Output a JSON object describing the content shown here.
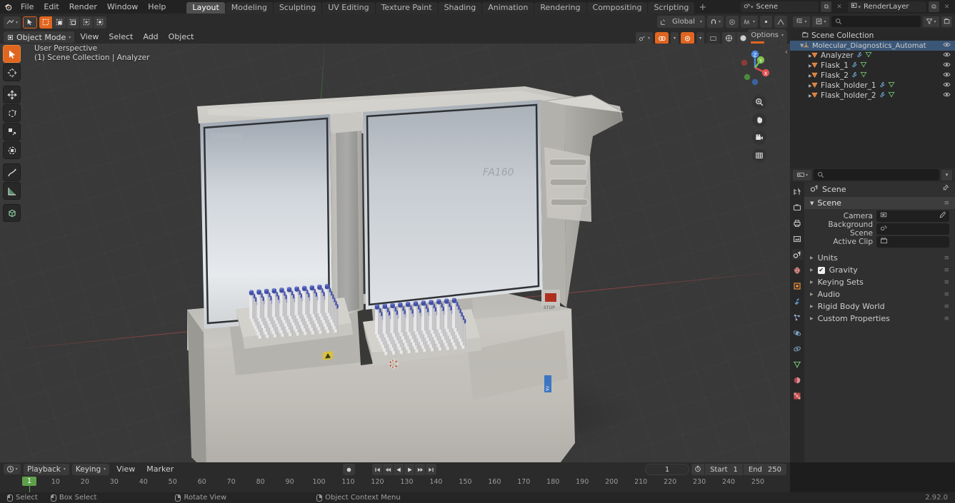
{
  "app": {
    "name": "Blender",
    "version": "2.92.0"
  },
  "topbar": {
    "logo_icon": "blender-logo-icon",
    "menus": [
      "File",
      "Edit",
      "Render",
      "Window",
      "Help"
    ],
    "workspace_tabs": [
      {
        "label": "Layout",
        "active": true
      },
      {
        "label": "Modeling",
        "active": false
      },
      {
        "label": "Sculpting",
        "active": false
      },
      {
        "label": "UV Editing",
        "active": false
      },
      {
        "label": "Texture Paint",
        "active": false
      },
      {
        "label": "Shading",
        "active": false
      },
      {
        "label": "Animation",
        "active": false
      },
      {
        "label": "Rendering",
        "active": false
      },
      {
        "label": "Compositing",
        "active": false
      },
      {
        "label": "Scripting",
        "active": false
      }
    ],
    "add_workspace_label": "+",
    "scene_name": "Scene",
    "view_layer_name": "RenderLayer",
    "new_scene_icon": "copy-icon",
    "remove_scene_icon": "x-icon",
    "new_layer_icon": "copy-icon",
    "remove_layer_icon": "x-icon"
  },
  "viewport": {
    "header": {
      "editor_type_icon": "editor-type-icon",
      "cursor_select_icon": "cursor-icon",
      "select_mode_icons": [
        "select-set-icon",
        "select-extend-icon",
        "select-subtract-icon",
        "select-invert-icon",
        "select-intersect-icon"
      ],
      "mode_label": "Object Mode",
      "mode_icon": "object-mode-icon",
      "menus": [
        "View",
        "Select",
        "Add",
        "Object"
      ],
      "transform_orientation": "Global",
      "orientation_icon": "orientation-icon",
      "snap_icon": "magnet-icon",
      "proportional_icon": "proportional-edit-icon",
      "proportional_falloff_icon": "falloff-icon",
      "options_label": "Options",
      "overlay_icons": [
        "gizmo-icon",
        "overlays-icon",
        "xray-icon",
        "shading-wireframe-icon",
        "shading-solid-icon",
        "shading-material-icon",
        "shading-rendered-icon"
      ]
    },
    "overlay": {
      "perspective_label": "User Perspective",
      "context_label": "(1) Scene Collection | Analyzer"
    },
    "toolbar": [
      {
        "name": "tweak-tool",
        "icon": "cursor-arrow-icon",
        "active": true
      },
      {
        "name": "cursor-tool",
        "icon": "3d-cursor-icon",
        "active": false
      },
      {
        "name": "move-tool",
        "icon": "move-arrows-icon",
        "active": false
      },
      {
        "name": "rotate-tool",
        "icon": "rotate-icon",
        "active": false
      },
      {
        "name": "scale-tool",
        "icon": "scale-icon",
        "active": false
      },
      {
        "name": "transform-tool",
        "icon": "transform-icon",
        "active": false
      },
      {
        "name": "annotate-tool",
        "icon": "pencil-icon",
        "active": false
      },
      {
        "name": "measure-tool",
        "icon": "ruler-icon",
        "active": false
      },
      {
        "name": "add-cube-tool",
        "icon": "add-cube-icon",
        "active": false
      }
    ],
    "gizmo": {
      "axis_x_label": "X",
      "axis_y_label": "Y",
      "axis_z_label": "Z",
      "color_x": "#e0504f",
      "color_y": "#7ec04b",
      "color_z": "#4c8ade"
    },
    "nav_buttons": [
      {
        "name": "zoom-button",
        "icon": "magnifier-icon"
      },
      {
        "name": "pan-button",
        "icon": "hand-icon"
      },
      {
        "name": "camera-view-button",
        "icon": "camera-icon"
      },
      {
        "name": "toggle-perspective-button",
        "icon": "grid-icon"
      }
    ],
    "scene_model": {
      "machine_label": "FA160",
      "brand_label": "FA160",
      "stop_button_label": "STOP",
      "rack_count": 2,
      "vial_cap_color": "#4350a8",
      "body_color": "#c8c6c1"
    }
  },
  "outliner": {
    "display_mode_icon": "outliner-icon",
    "filter_id_icon": "filter-id-icon",
    "search_placeholder": "",
    "search_icon": "search-icon",
    "filter_icon": "funnel-icon",
    "new_collection_icon": "new-collection-icon",
    "rows": [
      {
        "label": "Scene Collection",
        "indent": 0,
        "icon": "scene-collection-icon",
        "expand": "",
        "selected": false,
        "eye": false
      },
      {
        "label": "Molecular_Diagnostics_Automatic_Stool_An",
        "indent": 1,
        "icon": "empty-axes-icon",
        "expand": "▼",
        "selected": true,
        "eye": true
      },
      {
        "label": "Analyzer",
        "indent": 2,
        "icon": "mesh-icon",
        "expand": "▶",
        "selected": false,
        "eye": true,
        "extra_icons": [
          "modifier-icon",
          "mesh-data-icon"
        ]
      },
      {
        "label": "Flask_1",
        "indent": 2,
        "icon": "mesh-icon",
        "expand": "▶",
        "selected": false,
        "eye": true,
        "extra_icons": [
          "modifier-icon",
          "mesh-data-icon"
        ]
      },
      {
        "label": "Flask_2",
        "indent": 2,
        "icon": "mesh-icon",
        "expand": "▶",
        "selected": false,
        "eye": true,
        "extra_icons": [
          "modifier-icon",
          "mesh-data-icon"
        ]
      },
      {
        "label": "Flask_holder_1",
        "indent": 2,
        "icon": "mesh-icon",
        "expand": "▶",
        "selected": false,
        "eye": true,
        "extra_icons": [
          "modifier-icon",
          "mesh-data-icon"
        ]
      },
      {
        "label": "Flask_holder_2",
        "indent": 2,
        "icon": "mesh-icon",
        "expand": "▶",
        "selected": false,
        "eye": true,
        "extra_icons": [
          "modifier-icon",
          "mesh-data-icon"
        ]
      }
    ]
  },
  "properties": {
    "editor_icon": "properties-editor-icon",
    "search_placeholder": "",
    "search_icon": "search-icon",
    "options_icon": "chevron-down-icon",
    "tabs": [
      {
        "name": "tool-tab",
        "icon": "tool-icon",
        "active": false
      },
      {
        "name": "render-tab",
        "icon": "camera-back-icon",
        "active": false
      },
      {
        "name": "output-tab",
        "icon": "printer-icon",
        "active": false
      },
      {
        "name": "view-layer-tab",
        "icon": "images-icon",
        "active": false
      },
      {
        "name": "scene-tab",
        "icon": "scene-icon",
        "active": true
      },
      {
        "name": "world-tab",
        "icon": "world-icon",
        "active": false
      },
      {
        "name": "object-tab",
        "icon": "object-square-icon",
        "active": false
      },
      {
        "name": "modifier-tab",
        "icon": "wrench-icon",
        "active": false
      },
      {
        "name": "particles-tab",
        "icon": "particles-icon",
        "active": false
      },
      {
        "name": "physics-tab",
        "icon": "physics-icon",
        "active": false
      },
      {
        "name": "constraints-tab",
        "icon": "constraint-icon",
        "active": false
      },
      {
        "name": "data-tab",
        "icon": "data-triangle-icon",
        "active": false
      },
      {
        "name": "material-tab",
        "icon": "material-sphere-icon",
        "active": false
      },
      {
        "name": "texture-tab",
        "icon": "checker-icon",
        "active": false
      }
    ],
    "breadcrumb_label": "Scene",
    "breadcrumb_icon": "scene-icon",
    "pin_icon": "pin-icon",
    "panel_title": "Scene",
    "fields": [
      {
        "label": "Camera",
        "value": "",
        "icon": "camera-data-icon",
        "eyedropper": true
      },
      {
        "label": "Background Scene",
        "value": "",
        "icon": "scene-icon",
        "eyedropper": false
      },
      {
        "label": "Active Clip",
        "value": "",
        "icon": "clip-icon",
        "eyedropper": false
      }
    ],
    "subpanels": [
      {
        "label": "Units",
        "checkbox": null
      },
      {
        "label": "Gravity",
        "checkbox": true
      },
      {
        "label": "Keying Sets",
        "checkbox": null
      },
      {
        "label": "Audio",
        "checkbox": null
      },
      {
        "label": "Rigid Body World",
        "checkbox": null
      },
      {
        "label": "Custom Properties",
        "checkbox": null
      }
    ]
  },
  "timeline": {
    "editor_icon": "timeline-icon",
    "menus_dd": [
      "Playback",
      "Keying"
    ],
    "menus": [
      "View",
      "Marker"
    ],
    "record_icon": "record-icon",
    "playback_buttons": [
      "jump-start-icon",
      "prev-keyframe-icon",
      "play-reverse-icon",
      "play-icon",
      "next-keyframe-icon",
      "jump-end-icon"
    ],
    "current_frame": "1",
    "frame_icon": "stopwatch-icon",
    "start_label": "Start",
    "start_value": "1",
    "end_label": "End",
    "end_value": "250",
    "ticks": [
      10,
      20,
      30,
      40,
      50,
      60,
      70,
      80,
      90,
      100,
      110,
      120,
      130,
      140,
      150,
      160,
      170,
      180,
      190,
      200,
      210,
      220,
      230,
      240,
      250
    ],
    "playhead_label": "1"
  },
  "statusbar": {
    "items": [
      {
        "mouse": "left",
        "label": "Select"
      },
      {
        "mouse": "left",
        "label": "Box Select"
      },
      {
        "mouse": "middle",
        "label": "Rotate View"
      },
      {
        "mouse": "right",
        "label": "Object Context Menu"
      }
    ],
    "version_label": "2.92.0"
  }
}
